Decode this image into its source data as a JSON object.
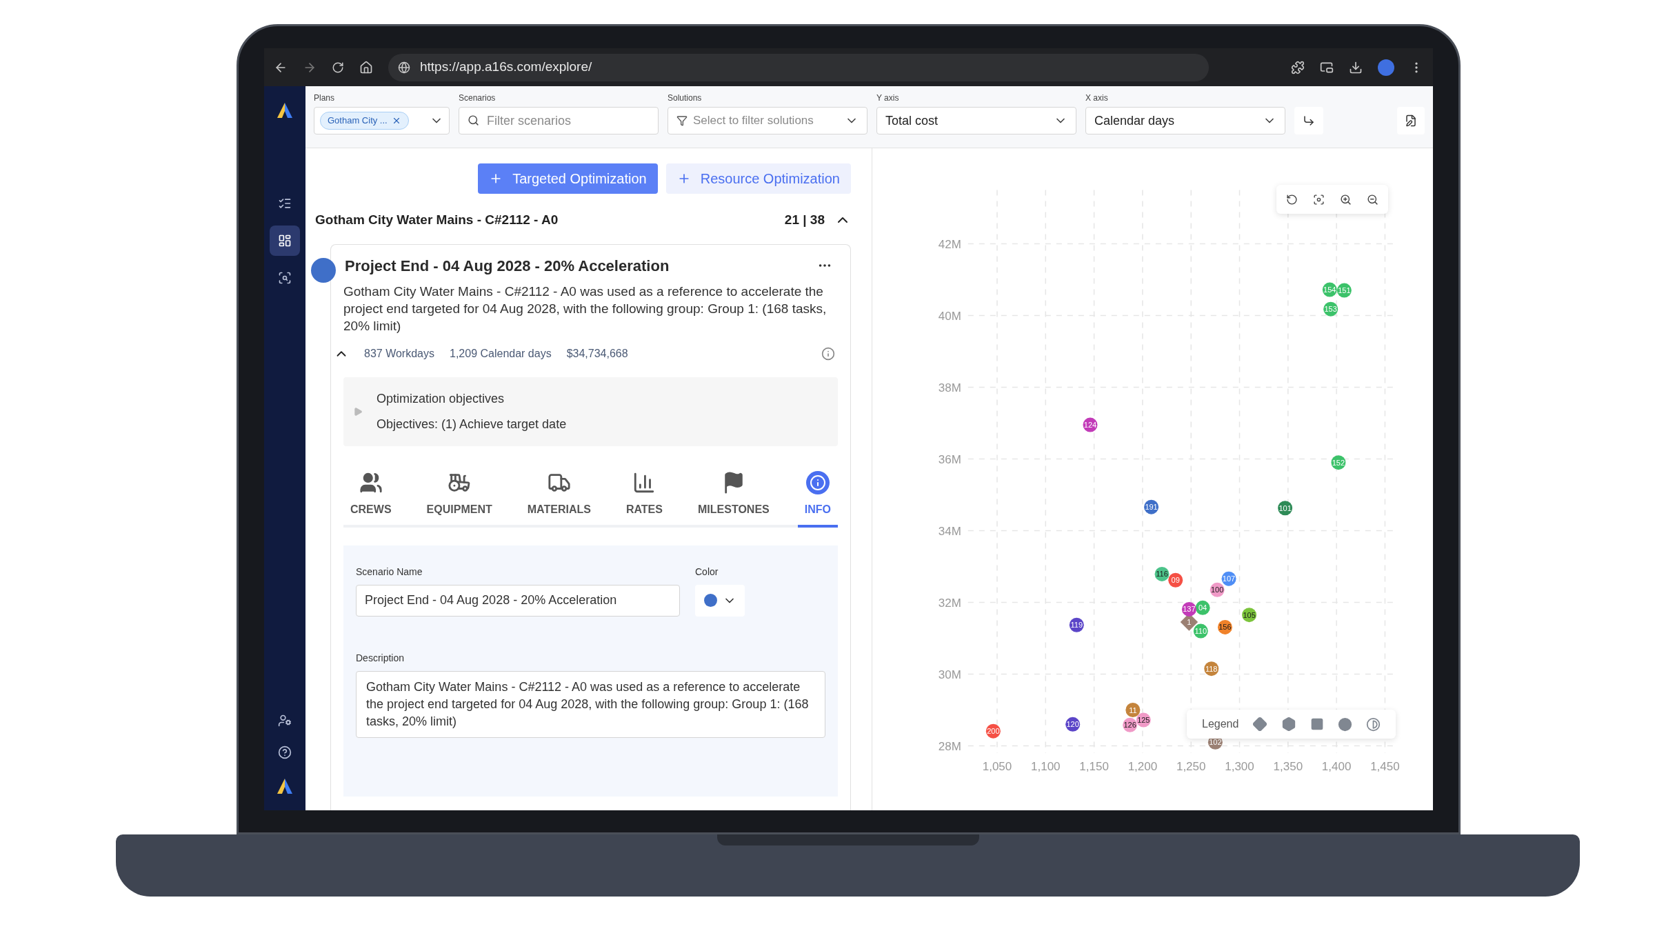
{
  "browser": {
    "url": "https://app.a16s.com/explore/"
  },
  "sidebar": {
    "items": [
      {
        "selected": false
      },
      {
        "selected": true
      },
      {
        "selected": false
      }
    ]
  },
  "filters": {
    "plans": {
      "label": "Plans",
      "chip": "Gotham City ..."
    },
    "scenarios": {
      "label": "Scenarios",
      "placeholder": "Filter scenarios"
    },
    "solutions": {
      "label": "Solutions",
      "placeholder": "Select to filter solutions"
    },
    "y_axis": {
      "label": "Y axis",
      "value": "Total cost"
    },
    "x_axis": {
      "label": "X axis",
      "value": "Calendar days"
    }
  },
  "actions": [
    {
      "label": "Targeted Optimization",
      "selected": true
    },
    {
      "label": "Resource Optimization",
      "selected": false
    }
  ],
  "plan": {
    "title": "Gotham City Water Mains - C#2112 - A0",
    "count": "21 | 38",
    "expanded": true
  },
  "scenario": {
    "color": "#3f6fc8",
    "title": "Project End - 04 Aug 2028 - 20% Acceleration",
    "description": "Gotham City Water Mains - C#2112 - A0 was used as a reference to accelerate the project end targeted for 04 Aug 2028, with the following group: Group 1: (168 tasks, 20% limit)",
    "stats": [
      "837 Workdays",
      "1,209 Calendar days",
      "$34,734,668"
    ],
    "objectives": {
      "expanded": false,
      "title": "Optimization objectives",
      "text": "Objectives: (1) Achieve target date"
    }
  },
  "tabs": [
    {
      "label": "CREWS",
      "selected": false
    },
    {
      "label": "EQUIPMENT",
      "selected": false
    },
    {
      "label": "MATERIALS",
      "selected": false
    },
    {
      "label": "RATES",
      "selected": false
    },
    {
      "label": "MILESTONES",
      "selected": false
    },
    {
      "label": "INFO",
      "selected": true
    }
  ],
  "form": {
    "name_label": "Scenario Name",
    "name_value": "Project End - 04 Aug 2028 - 20% Acceleration",
    "color_label": "Color",
    "color": "#3f6fc8",
    "description_label": "Description",
    "description_value": "Gotham City Water Mains - C#2112 - A0 was used as a reference to accelerate the project end targeted for 04 Aug 2028, with the following group: Group 1: (168 tasks, 20% limit)"
  },
  "chart": {
    "legend_label": "Legend",
    "points": [
      {
        "label": "154",
        "kind": "circle",
        "color": "#3cc26a"
      },
      {
        "label": "151",
        "kind": "circle",
        "color": "#3cc26a"
      },
      {
        "label": "153",
        "kind": "circle",
        "color": "#3cc26a"
      },
      {
        "label": "124",
        "kind": "circle",
        "color": "#c23bb8"
      },
      {
        "label": "152",
        "kind": "circle",
        "color": "#3cc26a"
      },
      {
        "label": "191",
        "kind": "circle",
        "color": "#3f6fc8"
      },
      {
        "label": "101",
        "kind": "circle",
        "color": "#2e8b57"
      },
      {
        "label": "09",
        "kind": "circle",
        "color": "#f55045"
      },
      {
        "label": "116",
        "kind": "circle",
        "color": "#4cc38a"
      },
      {
        "label": "107",
        "kind": "circle",
        "color": "#4f8ef5"
      },
      {
        "label": "100",
        "kind": "circle",
        "color": "#f09ac7"
      },
      {
        "label": "04",
        "kind": "circle",
        "color": "#3cc26a"
      },
      {
        "label": "1",
        "kind": "diamond",
        "color": "#9b8073"
      },
      {
        "label": "137",
        "kind": "circle",
        "color": "#c23bb8"
      },
      {
        "label": "110",
        "kind": "circle",
        "color": "#3cc26a"
      },
      {
        "label": "105",
        "kind": "circle",
        "color": "#7cc43c"
      },
      {
        "label": "156",
        "kind": "circle",
        "color": "#f0822a"
      },
      {
        "label": "119",
        "kind": "circle",
        "color": "#5b45c8"
      },
      {
        "label": "118",
        "kind": "circle",
        "color": "#c4843c"
      },
      {
        "label": "11",
        "kind": "circle",
        "color": "#c4843c"
      },
      {
        "label": "125",
        "kind": "circle",
        "color": "#f09ac7"
      },
      {
        "label": "126",
        "kind": "circle",
        "color": "#f09ac7"
      },
      {
        "label": "120",
        "kind": "circle",
        "color": "#5b45c8"
      },
      {
        "label": "200",
        "kind": "circle",
        "color": "#f55045"
      },
      {
        "label": "102",
        "kind": "circle",
        "color": "#9b8073"
      }
    ],
    "chart_data": {
      "type": "scatter",
      "grid": true,
      "xlim": [
        1020,
        1460
      ],
      "ylim": [
        27.8,
        43.5
      ],
      "xticks": [
        {
          "value": 1050,
          "label": "1,050"
        },
        {
          "value": 1100,
          "label": "1,100"
        },
        {
          "value": 1150,
          "label": "1,150"
        },
        {
          "value": 1200,
          "label": "1,200"
        },
        {
          "value": 1250,
          "label": "1,250"
        },
        {
          "value": 1300,
          "label": "1,300"
        },
        {
          "value": 1350,
          "label": "1,350"
        },
        {
          "value": 1400,
          "label": "1,400"
        },
        {
          "value": 1450,
          "label": "1,450"
        }
      ],
      "yticks": [
        {
          "value": 28,
          "label": "28M"
        },
        {
          "value": 30,
          "label": "30M"
        },
        {
          "value": 32,
          "label": "32M"
        },
        {
          "value": 34,
          "label": "34M"
        },
        {
          "value": 36,
          "label": "36M"
        },
        {
          "value": 38,
          "label": "38M"
        },
        {
          "value": 40,
          "label": "40M"
        },
        {
          "value": 42,
          "label": "42M"
        }
      ],
      "x": [
        1393,
        1408,
        1394,
        1146,
        1402,
        1209,
        1347,
        1234,
        1220,
        1289,
        1277,
        1262,
        1248,
        1248,
        1260,
        1310,
        1285,
        1132,
        1271,
        1190,
        1201,
        1187,
        1128,
        1046,
        1275
      ],
      "series": [
        {
          "values": [
            40.72,
            40.7,
            40.18,
            36.95,
            35.9,
            34.66,
            34.63,
            32.62,
            32.79,
            32.66,
            32.35,
            31.85,
            31.45,
            31.81,
            31.2,
            31.65,
            31.31,
            31.37,
            30.15,
            29.0,
            28.72,
            28.58,
            28.6,
            28.41,
            28.1
          ]
        }
      ]
    }
  }
}
